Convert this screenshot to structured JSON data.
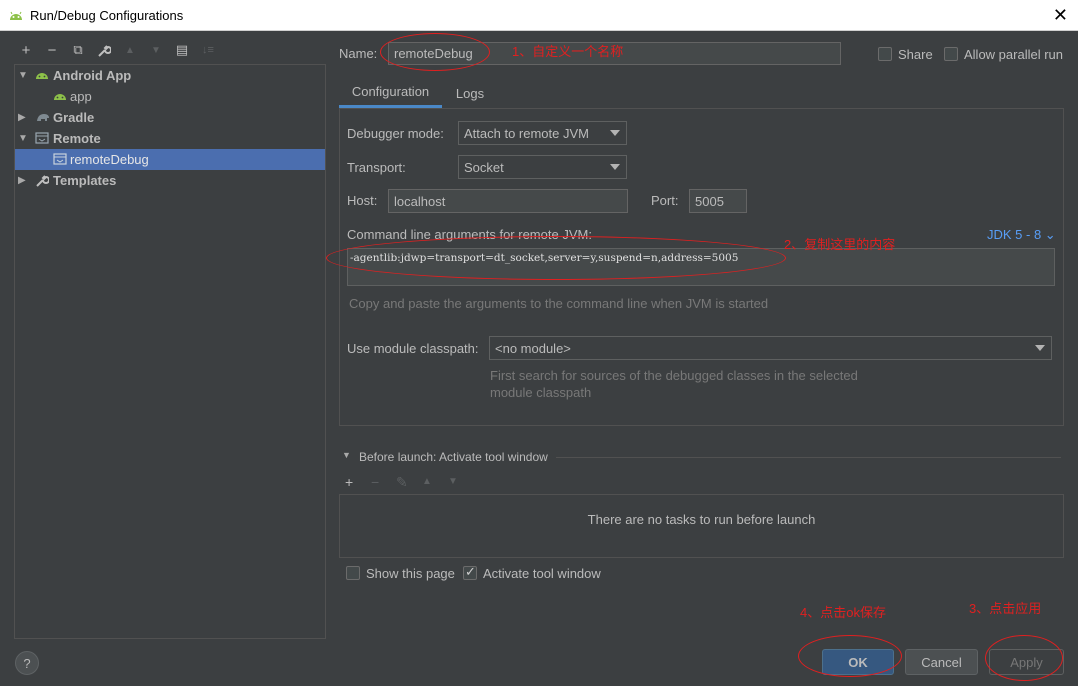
{
  "window": {
    "title": "Run/Debug Configurations",
    "close_glyph": "✕"
  },
  "toolbar": {
    "add": "+",
    "remove": "−",
    "copy": "⧉",
    "edit_defaults": "🔧",
    "move_up": "▲",
    "move_down": "▼",
    "folder": "▤",
    "sort": "↓≡"
  },
  "tree": {
    "items": [
      {
        "label": "Android App",
        "bold": true,
        "icon": "android-icon",
        "expanded": true
      },
      {
        "label": "app",
        "bold": false,
        "icon": "android-icon"
      },
      {
        "label": "Gradle",
        "bold": true,
        "icon": "gradle-icon",
        "expanded": false
      },
      {
        "label": "Remote",
        "bold": true,
        "icon": "remote-icon",
        "expanded": true
      },
      {
        "label": "remoteDebug",
        "bold": false,
        "icon": "remote-icon",
        "selected": true
      },
      {
        "label": "Templates",
        "bold": true,
        "icon": "wrench-icon",
        "expanded": false
      }
    ]
  },
  "help": "?",
  "name_row": {
    "label": "Name:",
    "value": "remoteDebug",
    "share_label": "Share",
    "share_checked": false,
    "parallel_label": "Allow parallel run",
    "parallel_checked": false
  },
  "tabs": [
    {
      "label": "Configuration",
      "active": true
    },
    {
      "label": "Logs",
      "active": false
    }
  ],
  "config": {
    "debugger_mode_label": "Debugger mode:",
    "debugger_mode_value": "Attach to remote JVM",
    "transport_label": "Transport:",
    "transport_value": "Socket",
    "host_label": "Host:",
    "host_value": "localhost",
    "port_label": "Port:",
    "port_value": "5005",
    "args_label": "Command line arguments for remote JVM:",
    "jdk_selector": "JDK 5 - 8 ⌄",
    "args_value": "-agentlib:jdwp=transport=dt_socket,server=y,suspend=n,address=5005",
    "args_hint": "Copy and paste the arguments to the command line when JVM is started",
    "classpath_label": "Use module classpath:",
    "classpath_value": "<no module>",
    "classpath_hint_1": "First search for sources of the debugged classes in the selected",
    "classpath_hint_2": "module classpath"
  },
  "before_launch": {
    "header": "Before launch: Activate tool window",
    "tools": {
      "add": "+",
      "remove": "−",
      "edit": "✎",
      "up": "▲",
      "down": "▼"
    },
    "empty_text": "There are no tasks to run before launch",
    "show_page_label": "Show this page",
    "show_page_checked": false,
    "activate_label": "Activate tool window",
    "activate_checked": true
  },
  "buttons": {
    "ok": "OK",
    "cancel": "Cancel",
    "apply": "Apply"
  },
  "annotations": {
    "a1": "1、自定义一个名称",
    "a2": "2、复制这里的内容",
    "a3": "3、点击应用",
    "a4": "4、点击ok保存",
    "color": "#e02020"
  },
  "colors": {
    "background": "#3c3f41",
    "selection": "#4b6eaf",
    "accent": "#4a88c7",
    "ok_button": "#365880"
  }
}
